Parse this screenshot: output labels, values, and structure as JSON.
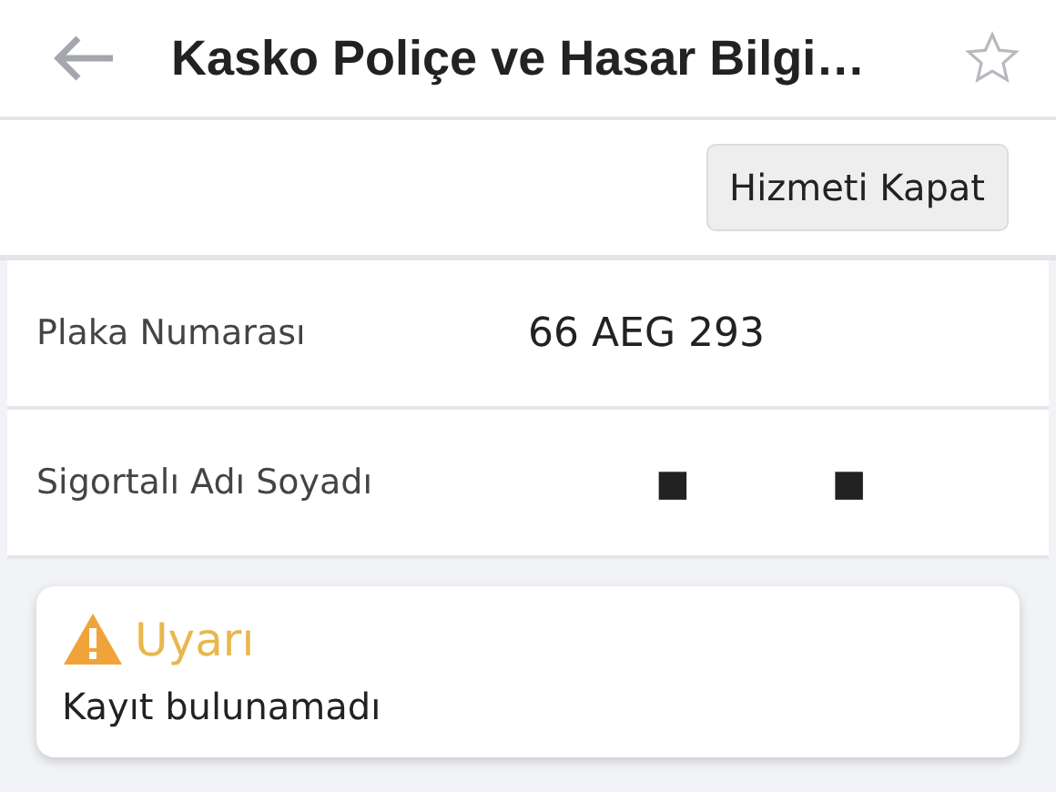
{
  "header": {
    "title": "Kasko Poliçe ve Hasar Bilgi…"
  },
  "toolbar": {
    "buttons": [
      "Hizmeti Kapat"
    ]
  },
  "fields": [
    {
      "label": "Plaka Numarası",
      "values": [
        "66 AEG 293"
      ]
    },
    {
      "label": "Sigortalı Adı Soyadı",
      "values": [
        "■",
        "■"
      ]
    }
  ],
  "alert": {
    "kind": "warning",
    "title": "Uyarı",
    "message": "Kayıt bulunamadı"
  }
}
